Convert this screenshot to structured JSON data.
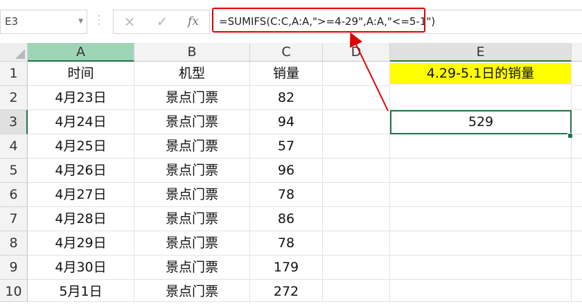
{
  "name_box": "E3",
  "formula_icons": {
    "cancel": "×",
    "enter": "✓",
    "fx": "fx"
  },
  "formula": "=SUMIFS(C:C,A:A,\">=4-29\",A:A,\"<=5-1\")",
  "columns": [
    "A",
    "B",
    "C",
    "D",
    "E"
  ],
  "rows": [
    {
      "num": "1",
      "a": "时间",
      "b": "机型",
      "c": "销量",
      "e": "4.29-5.1日的销量"
    },
    {
      "num": "2",
      "a": "4月23日",
      "b": "景点门票",
      "c": "82",
      "e": ""
    },
    {
      "num": "3",
      "a": "4月24日",
      "b": "景点门票",
      "c": "94",
      "e": "529"
    },
    {
      "num": "4",
      "a": "4月25日",
      "b": "景点门票",
      "c": "57",
      "e": ""
    },
    {
      "num": "5",
      "a": "4月26日",
      "b": "景点门票",
      "c": "96",
      "e": ""
    },
    {
      "num": "6",
      "a": "4月27日",
      "b": "景点门票",
      "c": "78",
      "e": ""
    },
    {
      "num": "7",
      "a": "4月28日",
      "b": "景点门票",
      "c": "86",
      "e": ""
    },
    {
      "num": "8",
      "a": "4月29日",
      "b": "景点门票",
      "c": "78",
      "e": ""
    },
    {
      "num": "9",
      "a": "4月30日",
      "b": "景点门票",
      "c": "179",
      "e": ""
    },
    {
      "num": "10",
      "a": "5月1日",
      "b": "景点门票",
      "c": "272",
      "e": ""
    }
  ],
  "colors": {
    "header_fill": "#ffff00",
    "selection": "#217346",
    "annotation": "#e00000"
  }
}
